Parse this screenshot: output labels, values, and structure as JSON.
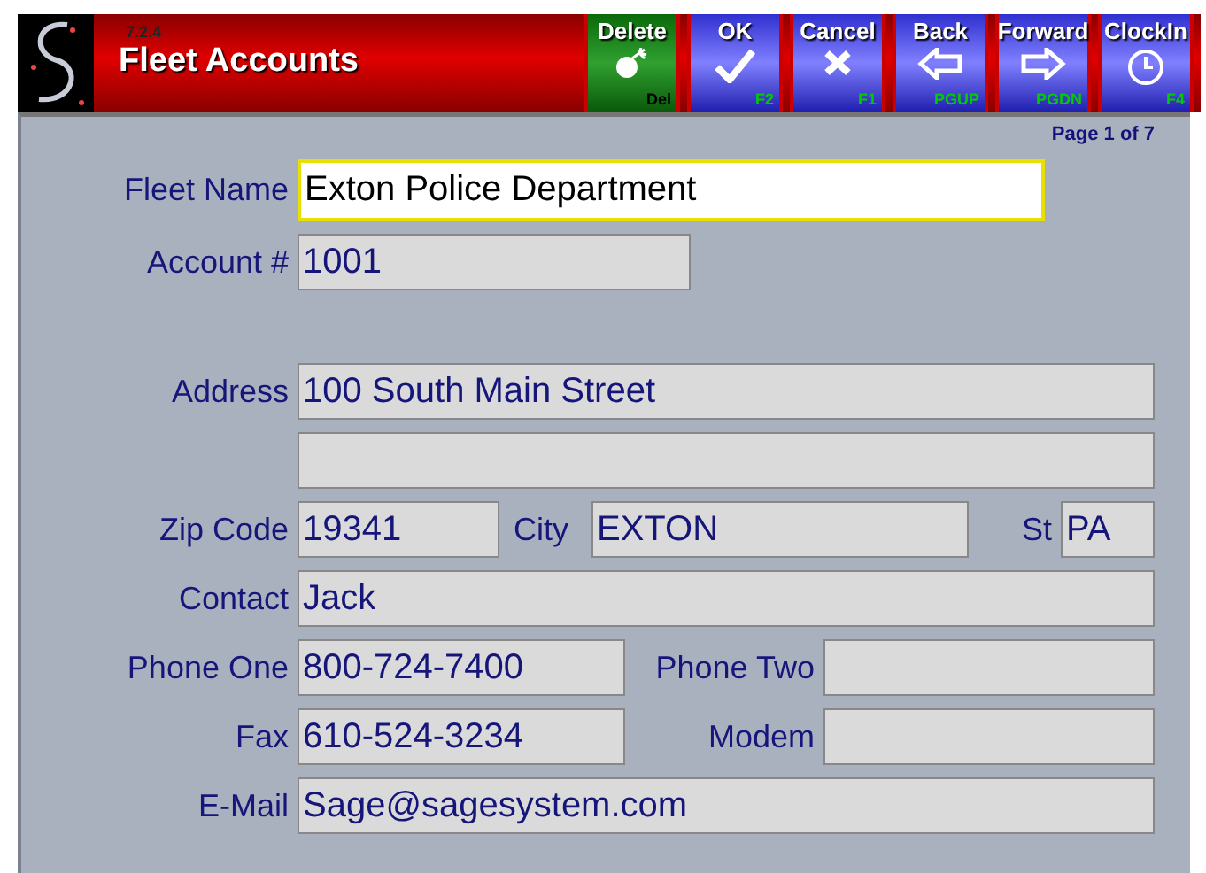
{
  "header": {
    "version": "7.2.4",
    "title": "Fleet Accounts"
  },
  "toolbar": [
    {
      "label": "Delete",
      "hotkey": "Del",
      "kind": "delete"
    },
    {
      "label": "OK",
      "hotkey": "F2",
      "kind": "ok"
    },
    {
      "label": "Cancel",
      "hotkey": "F1",
      "kind": "cancel"
    },
    {
      "label": "Back",
      "hotkey": "PGUP",
      "kind": "back"
    },
    {
      "label": "Forward",
      "hotkey": "PGDN",
      "kind": "forward"
    },
    {
      "label": "ClockIn",
      "hotkey": "F4",
      "kind": "clock"
    }
  ],
  "page_indicator": "Page 1 of 7",
  "sections": [
    {
      "rows": [
        {
          "fields": [
            {
              "label": "Fleet Name",
              "value": "Exton Police Department",
              "kind": "name",
              "focused": true
            }
          ]
        },
        {
          "fields": [
            {
              "label": "Account #",
              "value": "1001",
              "kind": "account",
              "focused": false
            }
          ]
        }
      ]
    },
    {
      "rows": [
        {
          "fields": [
            {
              "label": "Address",
              "value": "100 South Main Street",
              "kind": "full",
              "focused": false
            }
          ]
        },
        {
          "fields": [
            {
              "kind": "full",
              "focused": false
            }
          ]
        },
        {
          "fields": [
            {
              "label": "Zip Code",
              "value": "19341",
              "kind": "zip",
              "focused": false
            },
            {
              "label": "City",
              "value": "EXTON",
              "kind": "city",
              "focused": false
            },
            {
              "label": "St",
              "value": "PA",
              "kind": "state",
              "focused": false
            }
          ]
        },
        {
          "fields": [
            {
              "label": "Contact",
              "value": "Jack",
              "kind": "full",
              "focused": false
            }
          ]
        },
        {
          "fields": [
            {
              "label": "Phone One",
              "value": "800-724-7400",
              "kind": "phone",
              "focused": false
            },
            {
              "label": "Phone Two",
              "kind": "phone2",
              "focused": false
            }
          ]
        },
        {
          "fields": [
            {
              "label": "Fax",
              "value": "610-524-3234",
              "kind": "phone",
              "focused": false
            },
            {
              "label": "Modem",
              "kind": "phone2",
              "focused": false
            }
          ]
        },
        {
          "fields": [
            {
              "label": "E-Mail",
              "value": "Sage@sagesystem.com",
              "kind": "full",
              "focused": false
            }
          ]
        }
      ]
    }
  ]
}
